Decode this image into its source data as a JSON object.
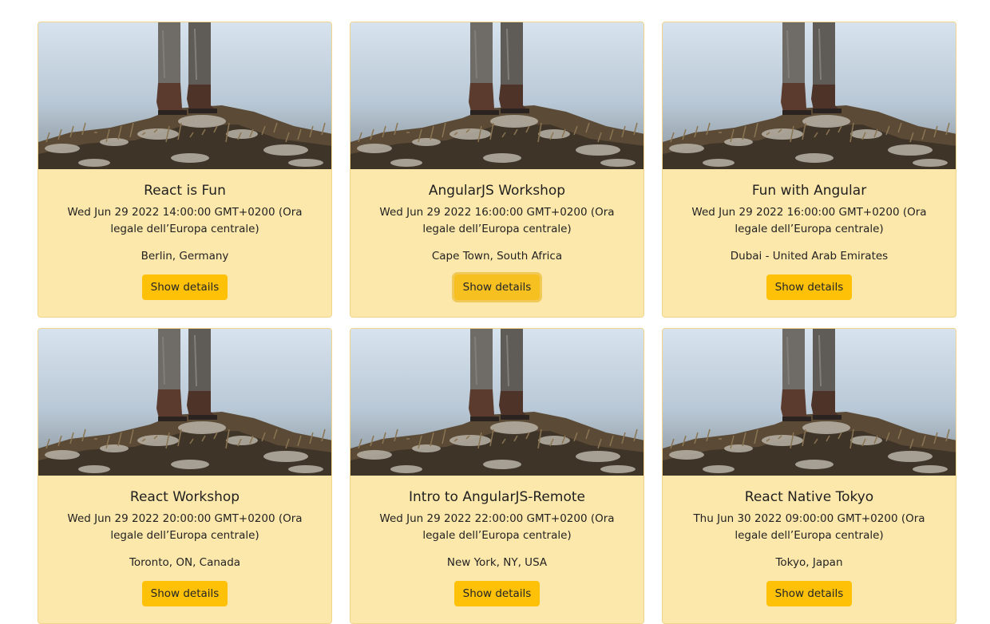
{
  "events": [
    {
      "title": "React is Fun",
      "date": "Wed Jun 29 2022 14:00:00 GMT+0200 (Ora legale dell’Europa centrale)",
      "location": "Berlin, Germany",
      "button": "Show details",
      "focused": false
    },
    {
      "title": "AngularJS Workshop",
      "date": "Wed Jun 29 2022 16:00:00 GMT+0200 (Ora legale dell’Europa centrale)",
      "location": "Cape Town, South Africa",
      "button": "Show details",
      "focused": true
    },
    {
      "title": "Fun with Angular",
      "date": "Wed Jun 29 2022 16:00:00 GMT+0200 (Ora legale dell’Europa centrale)",
      "location": "Dubai - United Arab Emirates",
      "button": "Show details",
      "focused": false
    },
    {
      "title": "React Workshop",
      "date": "Wed Jun 29 2022 20:00:00 GMT+0200 (Ora legale dell’Europa centrale)",
      "location": "Toronto, ON, Canada",
      "button": "Show details",
      "focused": false
    },
    {
      "title": "Intro to AngularJS-Remote",
      "date": "Wed Jun 29 2022 22:00:00 GMT+0200 (Ora legale dell’Europa centrale)",
      "location": "New York, NY, USA",
      "button": "Show details",
      "focused": false
    },
    {
      "title": "React Native Tokyo",
      "date": "Thu Jun 30 2022 09:00:00 GMT+0200 (Ora legale dell’Europa centrale)",
      "location": "Tokyo, Japan",
      "button": "Show details",
      "focused": false
    }
  ],
  "colors": {
    "card_background": "#fde8ab",
    "button_background": "#ffc107"
  }
}
